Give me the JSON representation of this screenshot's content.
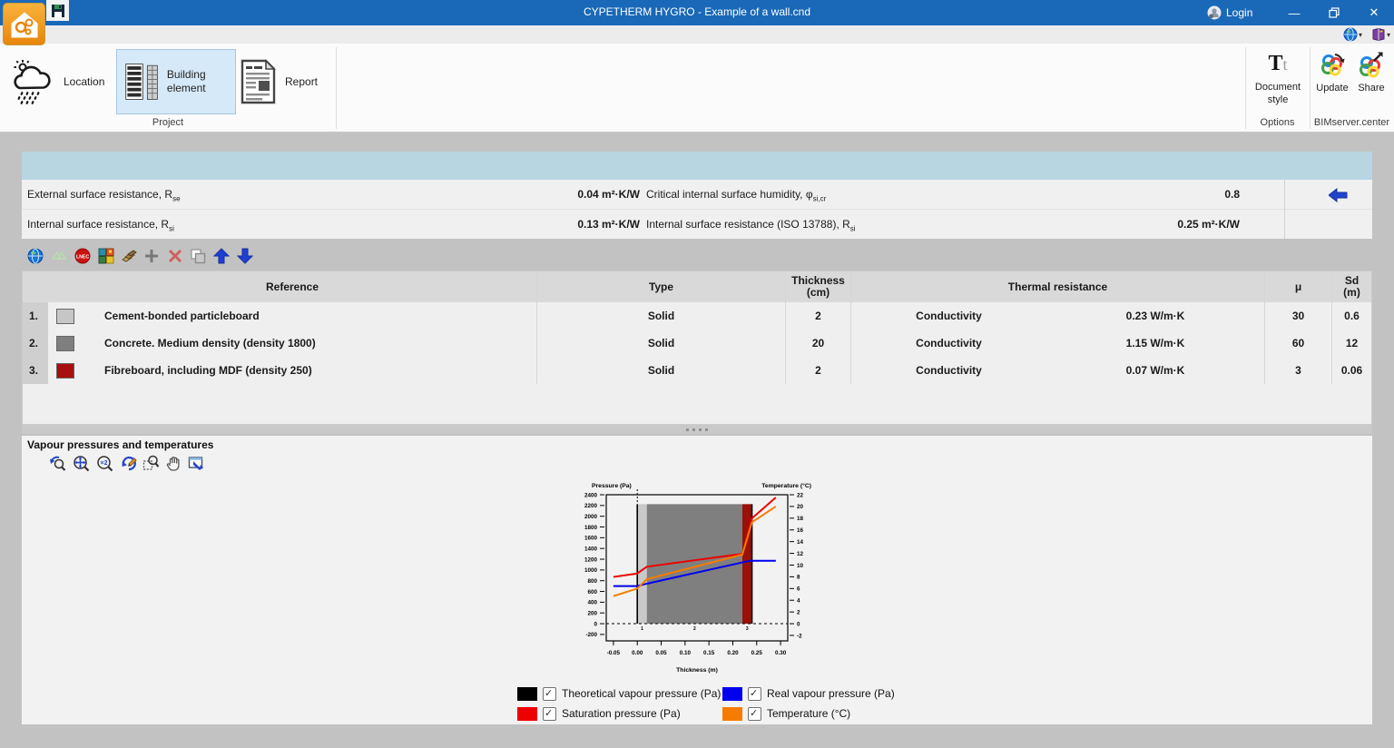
{
  "icons": {
    "caret_down": "▾",
    "check": "✓",
    "minimize": "—",
    "close": "✕"
  },
  "window": {
    "title": "CYPETHERM HYGRO - Example of a wall.cnd",
    "login_label": "Login"
  },
  "ribbon": {
    "location_label": "Location",
    "building_element_label": "Building element",
    "report_label": "Report",
    "document_style_label": "Document style",
    "update_label": "Update",
    "share_label": "Share",
    "group_project": "Project",
    "group_options": "Options",
    "group_bimserver": "BIMserver.center"
  },
  "surface_panel": {
    "rows": [
      {
        "left_label": "External surface resistance, R",
        "left_sub": "se",
        "left_value": "0.04 m²·K/W",
        "right_label": "Critical internal surface humidity, φ",
        "right_sub": "si,cr",
        "right_value": "0.8"
      },
      {
        "left_label": "Internal surface resistance, R",
        "left_sub": "si",
        "left_value": "0.13 m²·K/W",
        "right_label": "Internal surface resistance (ISO 13788), R",
        "right_sub": "si",
        "right_value": "0.25 m²·K/W"
      }
    ]
  },
  "layers_table": {
    "headers": {
      "reference": "Reference",
      "type": "Type",
      "thickness": [
        "Thickness",
        "(cm)"
      ],
      "thermal": "Thermal resistance",
      "mu": "μ",
      "sd": [
        "Sd",
        "(m)"
      ]
    },
    "rows": [
      {
        "num": "1.",
        "swatch": "#c6c6c6",
        "reference": "Cement-bonded particleboard",
        "type": "Solid",
        "thickness": "2",
        "thermal_mode": "Conductivity",
        "thermal_value": "0.23 W/m·K",
        "mu": "30",
        "sd": "0.6"
      },
      {
        "num": "2.",
        "swatch": "#7f7f7f",
        "reference": "Concrete. Medium density (density 1800)",
        "type": "Solid",
        "thickness": "20",
        "thermal_mode": "Conductivity",
        "thermal_value": "1.15 W/m·K",
        "mu": "60",
        "sd": "12"
      },
      {
        "num": "3.",
        "swatch": "#a80f0f",
        "reference": "Fibreboard, including MDF (density 250)",
        "type": "Solid",
        "thickness": "2",
        "thermal_mode": "Conductivity",
        "thermal_value": "0.07 W/m·K",
        "mu": "3",
        "sd": "0.06"
      }
    ]
  },
  "chart_section": {
    "title": "Vapour pressures and temperatures"
  },
  "chart_data": {
    "type": "line",
    "xlabel": "Thickness (m)",
    "ylabel_left": "Pressure (Pa)",
    "ylabel_right": "Temperature (°C)",
    "xlim": [
      -0.065,
      0.315
    ],
    "ylim_left": [
      -320,
      2400
    ],
    "right_to_left_factor": 109.0909,
    "x_ticks": [
      -0.05,
      0,
      0.05,
      0.1,
      0.15,
      0.2,
      0.25,
      0.3
    ],
    "y_ticks_left": [
      -200,
      0,
      200,
      400,
      600,
      800,
      1000,
      1200,
      1400,
      1600,
      1800,
      2000,
      2200,
      2400
    ],
    "y_ticks_right": [
      -2,
      0,
      2,
      4,
      6,
      8,
      10,
      12,
      14,
      16,
      18,
      20,
      22
    ],
    "grid": false,
    "zero_line_dashed": true,
    "layer_top": 2225,
    "boundary_lines_x": [
      0,
      0.24
    ],
    "layers": [
      {
        "x0": 0,
        "x1": 0.02,
        "color": "#c9c9c9",
        "label": "1"
      },
      {
        "x0": 0.02,
        "x1": 0.22,
        "color": "#7f7f7f",
        "label": "2"
      },
      {
        "x0": 0.22,
        "x1": 0.24,
        "color": "#9b1007",
        "label": "3"
      }
    ],
    "series": [
      {
        "name": "Theoretical vapour pressure (Pa)",
        "color": "#000000",
        "axis": "left",
        "points": []
      },
      {
        "name": "Saturation pressure (Pa)",
        "color": "#ee0000",
        "axis": "left",
        "points": [
          [
            -0.05,
            870
          ],
          [
            0,
            935
          ],
          [
            0.02,
            1060
          ],
          [
            0.22,
            1300
          ],
          [
            0.24,
            1960
          ],
          [
            0.29,
            2350
          ]
        ]
      },
      {
        "name": "Real vapour pressure (Pa)",
        "color": "#0000ee",
        "axis": "left",
        "points": [
          [
            -0.05,
            700
          ],
          [
            0,
            700
          ],
          [
            0.02,
            745
          ],
          [
            0.235,
            1170
          ],
          [
            0.29,
            1170
          ]
        ]
      },
      {
        "name": "Temperature (°C)",
        "color": "#f57c00",
        "axis": "right",
        "points": [
          [
            -0.05,
            4.7
          ],
          [
            0,
            6.0
          ],
          [
            0.02,
            7.6
          ],
          [
            0.22,
            11.8
          ],
          [
            0.24,
            17.3
          ],
          [
            0.29,
            20.0
          ]
        ]
      }
    ]
  },
  "legend": {
    "items": [
      {
        "label": "Theoretical vapour pressure (Pa)",
        "color": "#000000",
        "checked": true
      },
      {
        "label": "Real vapour pressure (Pa)",
        "color": "#0000ee",
        "checked": true
      },
      {
        "label": "Saturation pressure (Pa)",
        "color": "#ee0000",
        "checked": true
      },
      {
        "label": "Temperature (°C)",
        "color": "#f57c00",
        "checked": true
      }
    ]
  }
}
